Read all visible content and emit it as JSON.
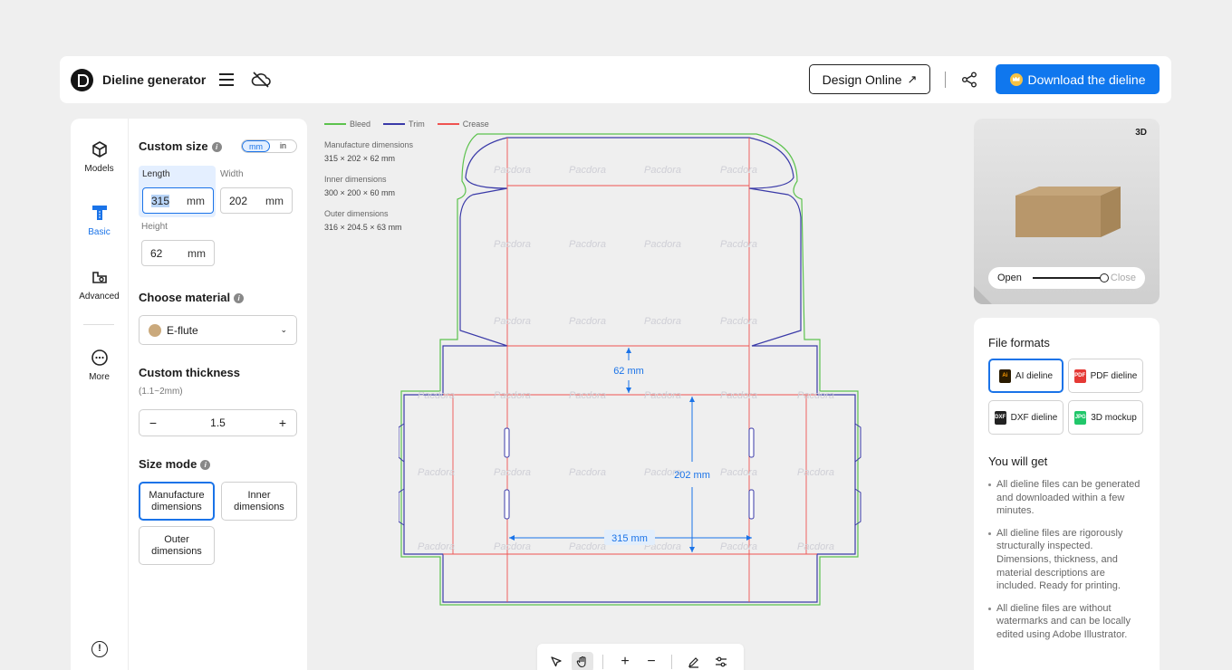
{
  "header": {
    "title": "Dieline generator",
    "design_online": "Design Online",
    "download": "Download the dieline",
    "accent": "#0f77ee"
  },
  "rail": {
    "items": [
      {
        "label": "Models",
        "icon": "cube-icon"
      },
      {
        "label": "Basic",
        "icon": "ruler-t-icon"
      },
      {
        "label": "Advanced",
        "icon": "box-settings-icon"
      },
      {
        "label": "More",
        "icon": "more-dots-icon"
      }
    ],
    "active": "Basic"
  },
  "form": {
    "custom_size": "Custom size",
    "units": [
      "mm",
      "in"
    ],
    "selected_unit": "mm",
    "length_label": "Length",
    "length_value": "315",
    "width_label": "Width",
    "width_value": "202",
    "height_label": "Height",
    "height_value": "62",
    "unit": "mm",
    "choose_material": "Choose material",
    "material": "E-flute",
    "custom_thickness": "Custom thickness",
    "thickness_hint": "(1.1~2mm)",
    "thickness_value": "1.5",
    "size_mode": "Size mode",
    "modes": [
      "Manufacture dimensions",
      "Inner dimensions",
      "Outer dimensions"
    ],
    "selected_mode": "Manufacture dimensions"
  },
  "canvas": {
    "legend": [
      {
        "label": "Bleed",
        "color": "#5cc24d"
      },
      {
        "label": "Trim",
        "color": "#3a3aa8"
      },
      {
        "label": "Crease",
        "color": "#ef5350"
      }
    ],
    "dims": [
      {
        "label": "Manufacture dimensions",
        "value": "315 × 202 × 62 mm"
      },
      {
        "label": "Inner dimensions",
        "value": "300 × 200 × 60 mm"
      },
      {
        "label": "Outer dimensions",
        "value": "316 × 204.5 × 63 mm"
      }
    ],
    "height_label": "62 mm",
    "width_label": "202 mm",
    "length_label": "315 mm",
    "watermark": "Pacdora"
  },
  "preview": {
    "badge": "3D",
    "open": "Open",
    "close": "Close",
    "open_level": 1.0
  },
  "formats": {
    "title": "File formats",
    "items": [
      {
        "label": "AI dieline",
        "badge": "Ai",
        "color": "#2a1b00"
      },
      {
        "label": "PDF dieline",
        "badge": "PDF",
        "color": "#e53935"
      },
      {
        "label": "DXF dieline",
        "badge": "DXF",
        "color": "#222222"
      },
      {
        "label": "3D mockup",
        "badge": "JPG",
        "color": "#21c76a"
      }
    ],
    "selected": "AI dieline",
    "you_will_get": "You will get",
    "bullets": [
      "All dieline files can be generated and downloaded within a few minutes.",
      "All dieline files are rigorously structurally inspected. Dimensions, thickness, and material descriptions are included. Ready for printing.",
      "All dieline files are without watermarks and can be locally edited using Adobe Illustrator."
    ]
  }
}
